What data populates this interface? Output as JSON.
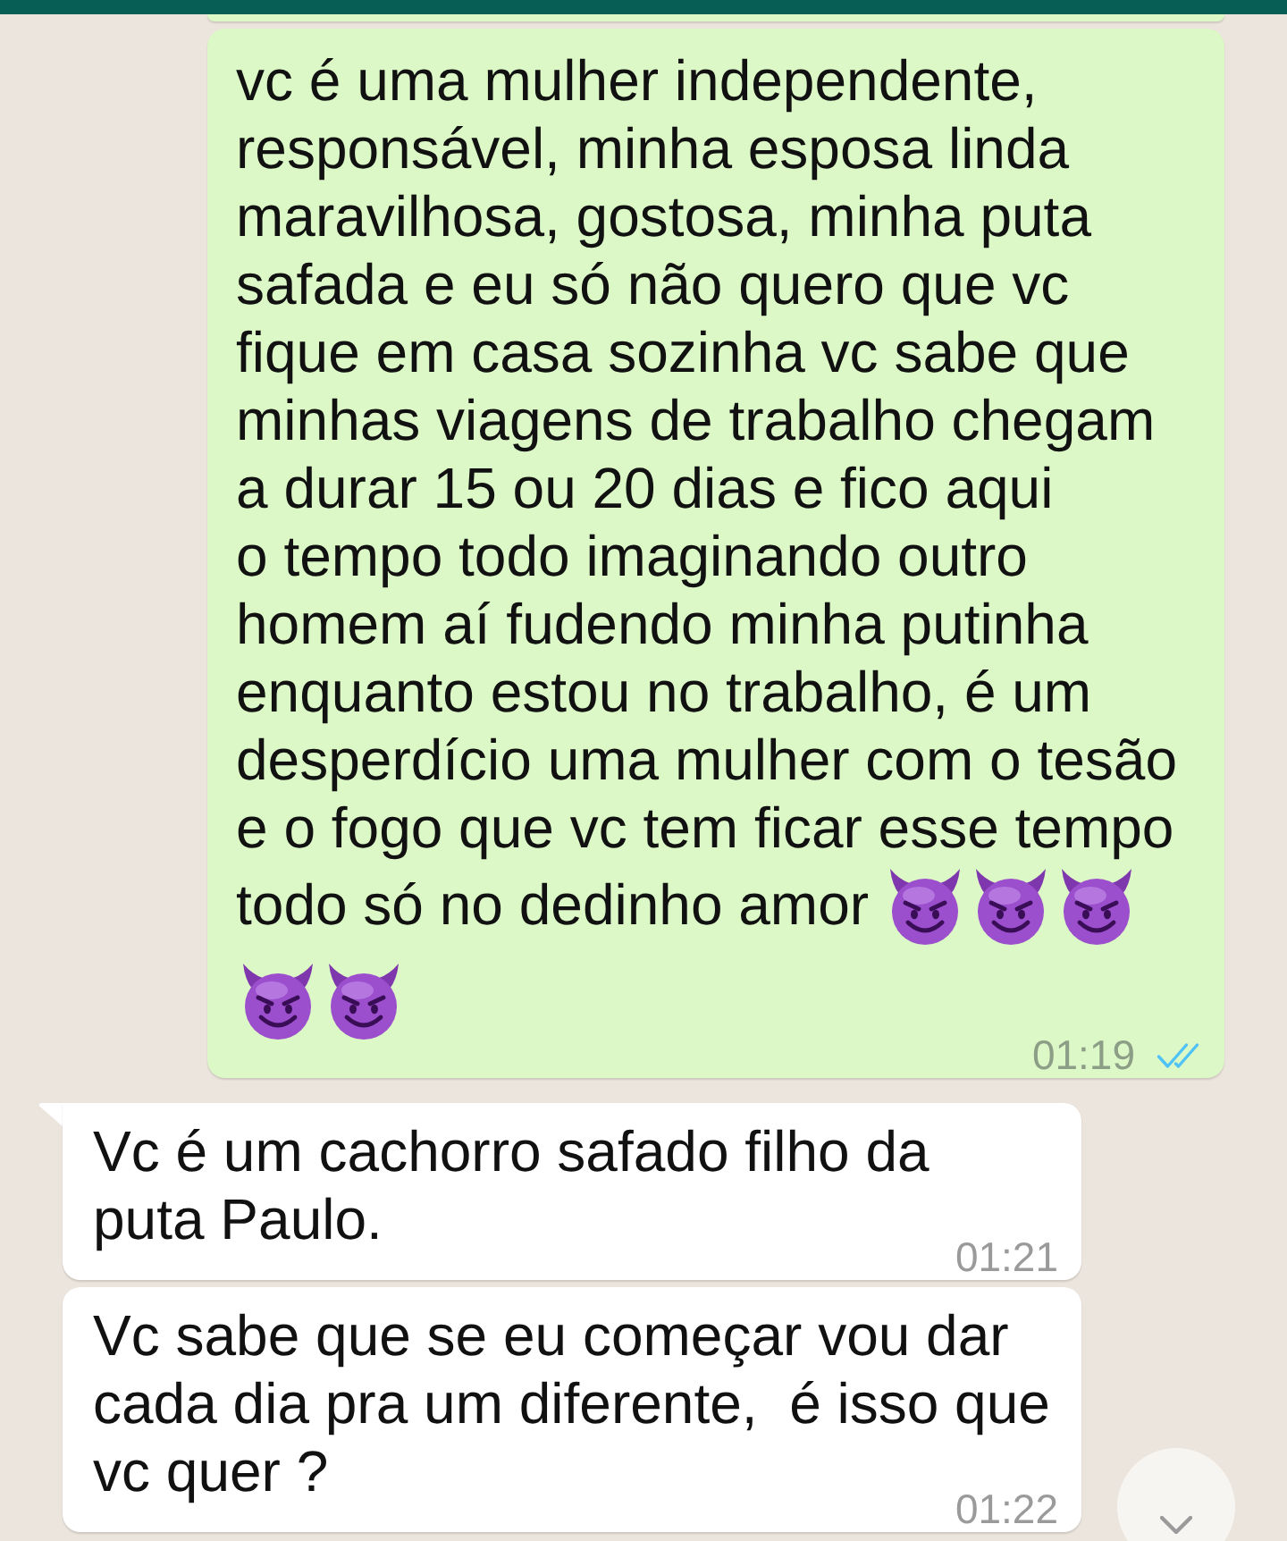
{
  "messages": [
    {
      "kind": "outgoing"
    },
    {
      "kind": "outgoing",
      "text": "vc é uma mulher independente, responsável, minha esposa linda maravilhosa, gostosa, minha puta safada e eu só não quero que vc fique em casa sozinha vc sabe que minhas viagens de trabalho chegam a durar 15 ou 20 dias e fico aqui\no tempo todo imaginando outro homem aí fudendo minha putinha enquanto estou no trabalho, é um desperdício uma mulher com o tesão e o fogo que vc tem ficar esse tempo todo só no dedinho amor",
      "emojis": [
        {
          "kind": "devil"
        },
        {
          "kind": "devil"
        },
        {
          "kind": "devil"
        },
        {
          "kind": "devil"
        },
        {
          "kind": "devil"
        }
      ],
      "time": "01:19",
      "read": true
    },
    {
      "kind": "incoming",
      "text": "Vc é um cachorro safado filho da puta Paulo.",
      "time": "01:21"
    },
    {
      "kind": "incoming",
      "text": "Vc sabe que se eu começar vou dar cada dia pra um diferente,  é isso que vc quer ?",
      "time": "01:22"
    }
  ]
}
